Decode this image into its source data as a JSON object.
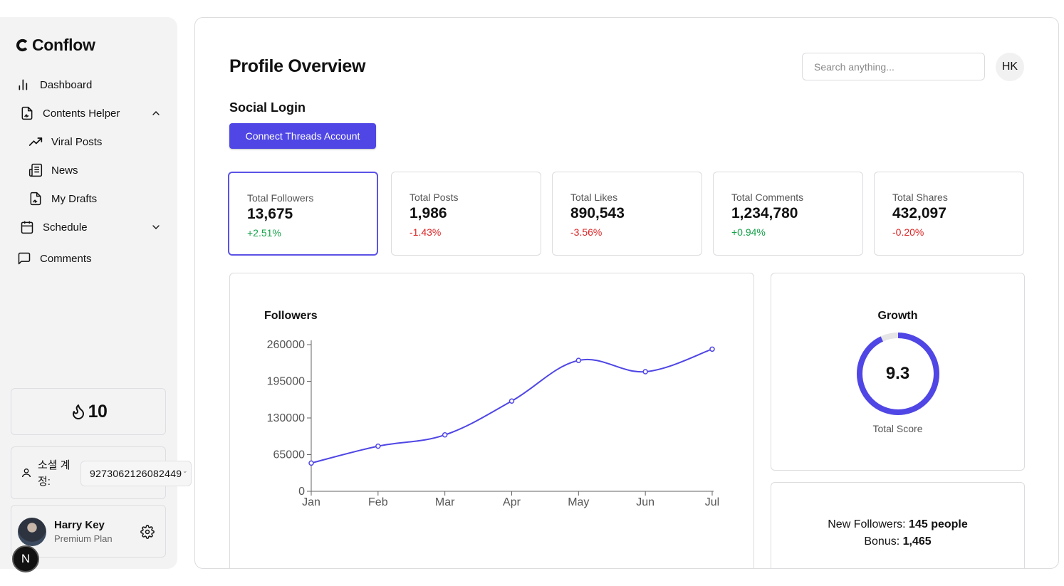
{
  "app": {
    "name": "Conflow"
  },
  "sidebar": {
    "items": [
      {
        "label": "Dashboard",
        "icon": "bar-chart-icon"
      },
      {
        "label": "Contents Helper",
        "icon": "file-signature-icon",
        "expanded": true
      },
      {
        "label": "Viral Posts",
        "icon": "trending-up-icon"
      },
      {
        "label": "News",
        "icon": "newspaper-icon"
      },
      {
        "label": "My Drafts",
        "icon": "file-signature-icon"
      },
      {
        "label": "Schedule",
        "icon": "calendar-icon",
        "expanded": false
      },
      {
        "label": "Comments",
        "icon": "message-square-icon"
      }
    ],
    "streak": {
      "value": "10",
      "icon": "flame-icon"
    },
    "account": {
      "label": "소셜 계정:",
      "value": "9273062126082449",
      "add_label": "계정"
    },
    "user": {
      "name": "Harry Key",
      "plan": "Premium Plan"
    },
    "badge": "N"
  },
  "header": {
    "title": "Profile Overview",
    "search_placeholder": "Search anything...",
    "avatar_initials": "HK"
  },
  "social_login": {
    "title": "Social Login",
    "button_label": "Connect Threads Account"
  },
  "stats": [
    {
      "label": "Total Followers",
      "value": "13,675",
      "change": "+2.51%",
      "trend": "up",
      "selected": true
    },
    {
      "label": "Total Posts",
      "value": "1,986",
      "change": "-1.43%",
      "trend": "down",
      "selected": false
    },
    {
      "label": "Total Likes",
      "value": "890,543",
      "change": "-3.56%",
      "trend": "down",
      "selected": false
    },
    {
      "label": "Total Comments",
      "value": "1,234,780",
      "change": "+0.94%",
      "trend": "up",
      "selected": false
    },
    {
      "label": "Total Shares",
      "value": "432,097",
      "change": "-0.20%",
      "trend": "down",
      "selected": false
    }
  ],
  "chart_data": {
    "type": "line",
    "title": "Followers",
    "categories": [
      "Jan",
      "Feb",
      "Mar",
      "Apr",
      "May",
      "Jun",
      "Jul"
    ],
    "series": [
      {
        "values": [
          50000,
          80000,
          100000,
          160000,
          232000,
          212000,
          252000
        ]
      }
    ],
    "yticks": [
      0,
      65000,
      130000,
      195000,
      260000
    ],
    "ylim": [
      0,
      260000
    ],
    "color": "#4f46e5",
    "grid": false,
    "legend": "none"
  },
  "growth": {
    "title": "Growth",
    "score": "9.3",
    "score_fraction": 0.93,
    "label": "Total Score",
    "color": "#4f46e5"
  },
  "new_followers": {
    "followers_label": "New Followers:",
    "followers_value": "145 people",
    "bonus_label": "Bonus:",
    "bonus_value": "1,465"
  }
}
